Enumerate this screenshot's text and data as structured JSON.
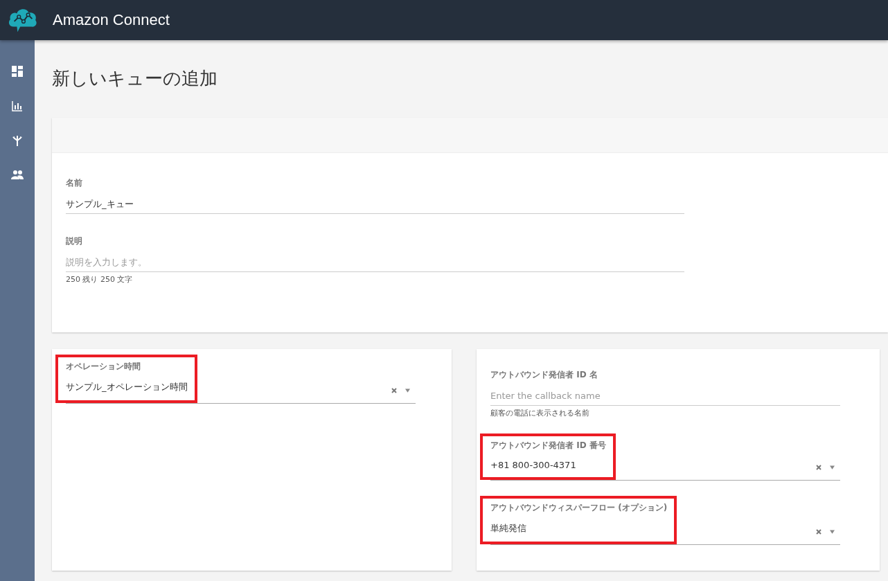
{
  "app": {
    "title": "Amazon Connect"
  },
  "page": {
    "title": "新しいキューの追加"
  },
  "queue_form": {
    "fields": [
      {
        "kind": "text",
        "label": "名前",
        "value": "サンプル_キュー"
      },
      {
        "kind": "text",
        "label": "説明",
        "placeholder": "説明を入力します。",
        "hint": "250 残り 250 文字"
      }
    ]
  },
  "left_panel": {
    "fields": [
      {
        "kind": "select",
        "label": "オペレーション時間",
        "value": "サンプル_オペレーション時間",
        "highlighted": true
      }
    ]
  },
  "right_panel": {
    "fields": [
      {
        "kind": "text",
        "label": "アウトバウンド発信者 ID 名",
        "placeholder": "Enter the callback name",
        "hint": "顧客の電話に表示される名前",
        "highlighted": false
      },
      {
        "kind": "select",
        "label": "アウトバウンド発信者 ID 番号",
        "value": "+81 800-300-4371",
        "highlighted": true
      },
      {
        "kind": "select",
        "label": "アウトバウンドウィスパーフロー (オプション)",
        "value": "単純発信",
        "highlighted": true
      }
    ]
  }
}
